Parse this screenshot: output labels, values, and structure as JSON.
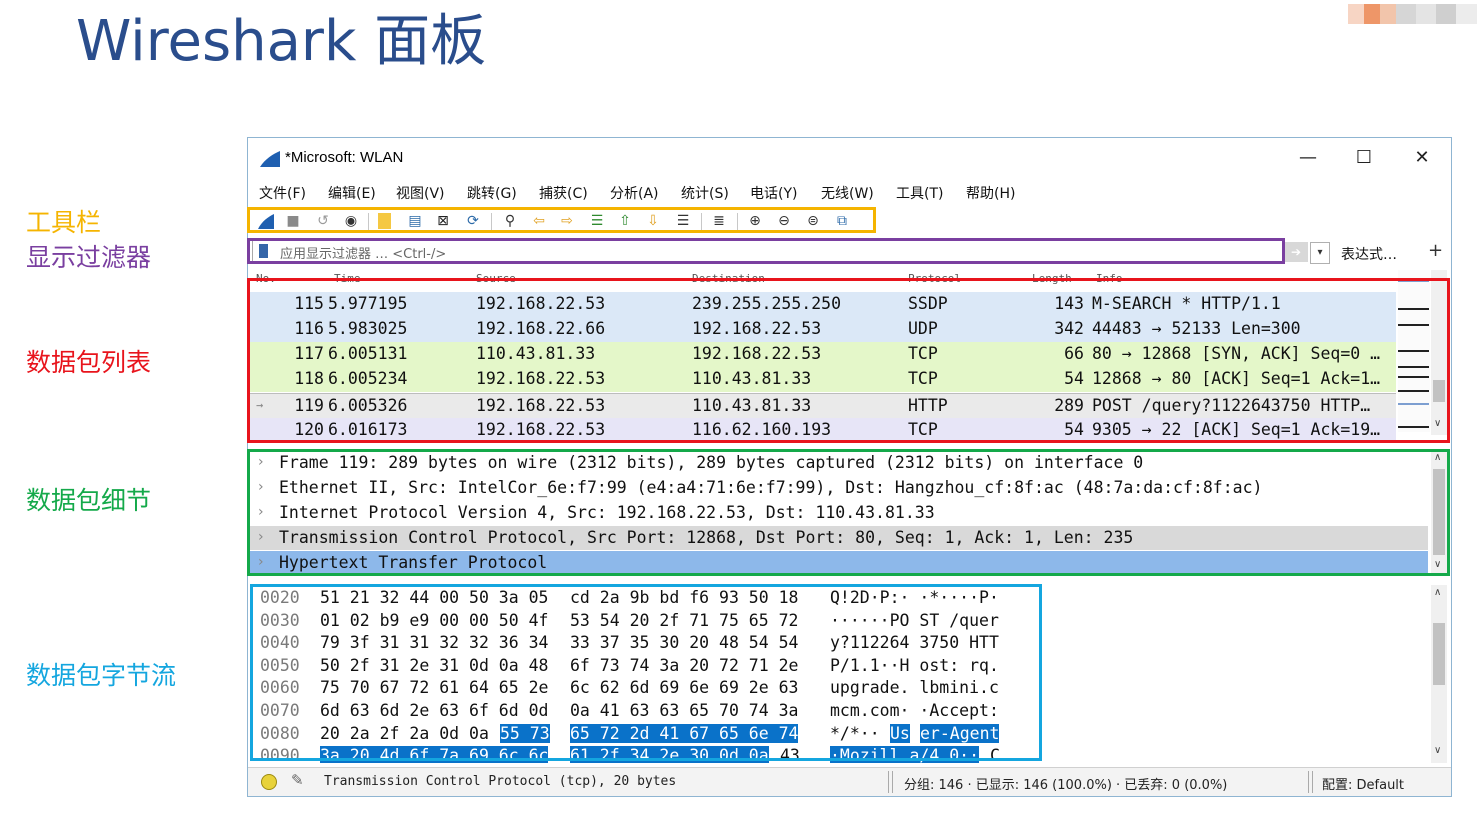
{
  "slide": {
    "title": "Wireshark 面板"
  },
  "labels": {
    "toolbar": {
      "text": "工具栏",
      "color": "#f5b400"
    },
    "display_filter": {
      "text": "显示过滤器",
      "color": "#7a3fa0"
    },
    "packet_list": {
      "text": "数据包列表",
      "color": "#e8141c"
    },
    "packet_details": {
      "text": "数据包细节",
      "color": "#14a94a"
    },
    "packet_bytes": {
      "text": "数据包字节流",
      "color": "#14a6df"
    }
  },
  "window": {
    "title": "*Microsoft: WLAN",
    "controls": {
      "minimize": "—",
      "maximize": "☐",
      "close": "✕"
    }
  },
  "menu": [
    "文件(F)",
    "编辑(E)",
    "视图(V)",
    "跳转(G)",
    "捕获(C)",
    "分析(A)",
    "统计(S)",
    "电话(Y)",
    "无线(W)",
    "工具(T)",
    "帮助(H)"
  ],
  "toolbar_icons": [
    "shark-fin-start-icon",
    "stop-icon",
    "restart-icon",
    "options-icon",
    "open-file-icon",
    "save-icon",
    "close-file-icon",
    "reload-icon",
    "find-icon",
    "back-icon",
    "forward-icon",
    "goto-packet-icon",
    "first-packet-icon",
    "last-packet-icon",
    "autoscroll-icon",
    "colorize-icon",
    "zoom-in-icon",
    "zoom-out-icon",
    "zoom-normal-icon",
    "resize-columns-icon"
  ],
  "filter": {
    "placeholder": "应用显示过滤器 … <Ctrl-/>",
    "expression_label": "表达式…",
    "add_label": "+"
  },
  "packet_list": {
    "columns": [
      "No.",
      "Time",
      "Source",
      "Destination",
      "Protocol",
      "Length",
      "Info"
    ],
    "rows": [
      {
        "no": "115",
        "time": "5.977195",
        "src": "192.168.22.53",
        "dst": "239.255.255.250",
        "proto": "SSDP",
        "len": "143",
        "info": "M-SEARCH * HTTP/1.1",
        "bg": "#dbe8f7"
      },
      {
        "no": "116",
        "time": "5.983025",
        "src": "192.168.22.66",
        "dst": "192.168.22.53",
        "proto": "UDP",
        "len": "342",
        "info": "44483 → 52133 Len=300",
        "bg": "#dbe8f7"
      },
      {
        "no": "117",
        "time": "6.005131",
        "src": "110.43.81.33",
        "dst": "192.168.22.53",
        "proto": "TCP",
        "len": "66",
        "info": "80 → 12868 [SYN, ACK] Seq=0 …",
        "bg": "#e4f7c9"
      },
      {
        "no": "118",
        "time": "6.005234",
        "src": "192.168.22.53",
        "dst": "110.43.81.33",
        "proto": "TCP",
        "len": "54",
        "info": "12868 → 80 [ACK] Seq=1 Ack=1…",
        "bg": "#e4f7c9"
      },
      {
        "no": "119",
        "time": "6.005326",
        "src": "192.168.22.53",
        "dst": "110.43.81.33",
        "proto": "HTTP",
        "len": "289",
        "info": "POST /query?1122643750 HTTP…",
        "bg": "#eaeaea"
      },
      {
        "no": "120",
        "time": "6.016173",
        "src": "192.168.22.53",
        "dst": "116.62.160.193",
        "proto": "TCP",
        "len": "54",
        "info": "9305 → 22 [ACK] Seq=1 Ack=19…",
        "bg": "#e7e5f7"
      }
    ]
  },
  "packet_details": [
    {
      "text": "Frame 119: 289 bytes on wire (2312 bits), 289 bytes captured (2312 bits) on interface 0",
      "bg": "#ffffff"
    },
    {
      "text": "Ethernet II, Src: IntelCor_6e:f7:99 (e4:a4:71:6e:f7:99), Dst: Hangzhou_cf:8f:ac (48:7a:da:cf:8f:ac)",
      "bg": "#ffffff"
    },
    {
      "text": "Internet Protocol Version 4, Src: 192.168.22.53, Dst: 110.43.81.33",
      "bg": "#ffffff"
    },
    {
      "text": "Transmission Control Protocol, Src Port: 12868, Dst Port: 80, Seq: 1, Ack: 1, Len: 235",
      "bg": "#d9d9d9"
    },
    {
      "text": "Hypertext Transfer Protocol",
      "bg": "#8db8ea"
    }
  ],
  "packet_bytes": [
    {
      "off": "0020",
      "hex1": "51 21 32 44 00 50 3a 05",
      "hex2": "cd 2a 9b bd f6 93 50 18",
      "ascii": "Q!2D·P:· ·*····P·"
    },
    {
      "off": "0030",
      "hex1": "01 02 b9 e9 00 00 50 4f",
      "hex2": "53 54 20 2f 71 75 65 72",
      "ascii": "······PO ST /quer"
    },
    {
      "off": "0040",
      "hex1": "79 3f 31 31 32 32 36 34",
      "hex2": "33 37 35 30 20 48 54 54",
      "ascii": "y?112264 3750 HTT"
    },
    {
      "off": "0050",
      "hex1": "50 2f 31 2e 31 0d 0a 48",
      "hex2": "6f 73 74 3a 20 72 71 2e",
      "ascii": "P/1.1··H ost: rq."
    },
    {
      "off": "0060",
      "hex1": "75 70 67 72 61 64 65 2e",
      "hex2": "6c 62 6d 69 6e 69 2e 63",
      "ascii": "upgrade. lbmini.c"
    },
    {
      "off": "0070",
      "hex1": "6d 63 6d 2e 63 6f 6d 0d",
      "hex2": "0a 41 63 63 65 70 74 3a",
      "ascii": "mcm.com· ·Accept:"
    }
  ],
  "bytes_row_80": {
    "off": "0080",
    "hex_plain": "20 2a 2f 2a 0d 0a",
    "hex_hl_a": "55 73",
    "hex_hl_b": "65 72 2d 41 67 65 6e 74",
    "ascii_plain": " */*··",
    "ascii_hl_a": "Us",
    "ascii_hl_b": "er-Agent"
  },
  "bytes_row_90": {
    "off": "0090",
    "hex_hl_a": "3a 20 4d 6f 7a 69 6c 6c",
    "hex_hl_b": "61 2f 34 2e 30 0d 0a",
    "hex_plain": "43",
    "ascii_hl": "·Mozill a/4.0··",
    "ascii_plain": "C"
  },
  "status": {
    "text": "Transmission Control Protocol (tcp), 20 bytes",
    "packets": "分组: 146 · 已显示: 146 (100.0%) · 已丢弃: 0 (0.0%)",
    "profile": "配置: Default"
  }
}
